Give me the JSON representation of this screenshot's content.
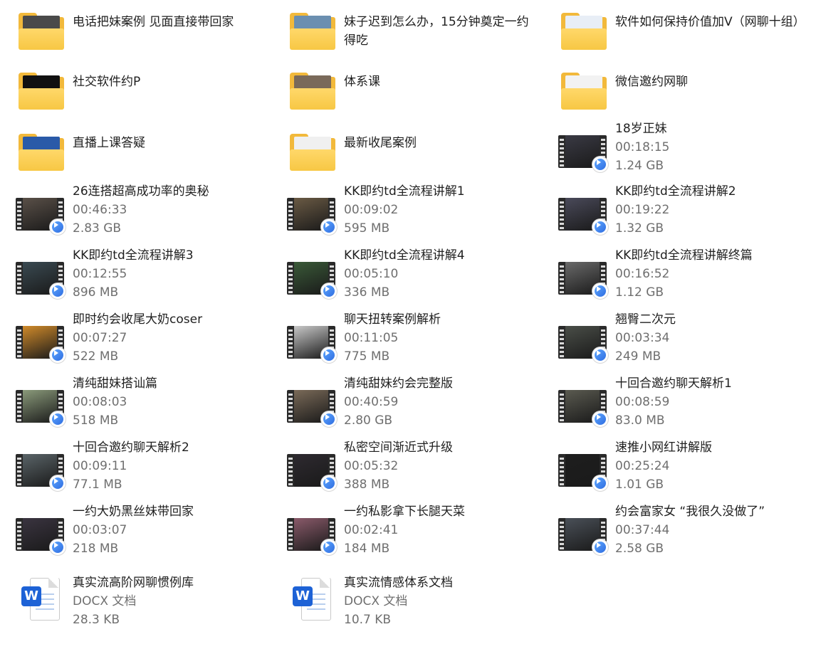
{
  "accent": "#2f6de0",
  "folder_color": "#f7c744",
  "items": [
    {
      "kind": "folder",
      "name": "电话把妹案例 见面直接带回家",
      "paper": "#4a4a4a",
      "icon": "folder-icon"
    },
    {
      "kind": "folder",
      "name": "妹子迟到怎么办，15分钟奠定一约得吃",
      "paper": "#6b8fb0",
      "icon": "folder-icon"
    },
    {
      "kind": "folder",
      "name": "软件如何保持价值加V（网聊十组）",
      "paper": "#e8eef6",
      "icon": "folder-icon"
    },
    {
      "kind": "folder",
      "name": "社交软件约P",
      "paper": "#111111",
      "icon": "folder-icon"
    },
    {
      "kind": "folder",
      "name": "体系课",
      "paper": "#7a6a5a",
      "icon": "folder-icon"
    },
    {
      "kind": "folder",
      "name": "微信邀约网聊",
      "paper": "#f2f2f2",
      "icon": "folder-icon"
    },
    {
      "kind": "folder",
      "name": "直播上课答疑",
      "paper": "#2a5aa8",
      "icon": "folder-icon"
    },
    {
      "kind": "folder",
      "name": "最新收尾案例",
      "paper": "#f0f0f0",
      "icon": "folder-icon"
    },
    {
      "kind": "video",
      "name": "18岁正妹",
      "duration": "00:18:15",
      "size": "1.24 GB",
      "frame": "#3a3a44",
      "icon": "video-icon"
    },
    {
      "kind": "video",
      "name": "26连搭超高成功率的奥秘",
      "duration": "00:46:33",
      "size": "2.83 GB",
      "frame": "#5a5048",
      "icon": "video-icon"
    },
    {
      "kind": "video",
      "name": "KK即约td全流程讲解1",
      "duration": "00:09:02",
      "size": "595 MB",
      "frame": "#6a5a44",
      "icon": "video-icon"
    },
    {
      "kind": "video",
      "name": "KK即约td全流程讲解2",
      "duration": "00:19:22",
      "size": "1.32 GB",
      "frame": "#4a4a5a",
      "icon": "video-icon"
    },
    {
      "kind": "video",
      "name": "KK即约td全流程讲解3",
      "duration": "00:12:55",
      "size": "896 MB",
      "frame": "#3a4a52",
      "icon": "video-icon"
    },
    {
      "kind": "video",
      "name": "KK即约td全流程讲解4",
      "duration": "00:05:10",
      "size": "336 MB",
      "frame": "#3a5a38",
      "icon": "video-icon"
    },
    {
      "kind": "video",
      "name": "KK即约td全流程讲解终篇",
      "duration": "00:16:52",
      "size": "1.12 GB",
      "frame": "#6a6a6a",
      "icon": "video-icon"
    },
    {
      "kind": "video",
      "name": "即时约会收尾大奶coser",
      "duration": "00:07:27",
      "size": "522 MB",
      "frame": "#d08a2a",
      "icon": "video-icon"
    },
    {
      "kind": "video",
      "name": "聊天扭转案例解析",
      "duration": "00:11:05",
      "size": "775 MB",
      "frame": "#c8c8c8",
      "icon": "video-icon"
    },
    {
      "kind": "video",
      "name": "翘臀二次元",
      "duration": "00:03:34",
      "size": "249 MB",
      "frame": "#4a4e48",
      "icon": "video-icon"
    },
    {
      "kind": "video",
      "name": "清纯甜妹搭讪篇",
      "duration": "00:08:03",
      "size": "518 MB",
      "frame": "#8a9a7a",
      "icon": "video-icon"
    },
    {
      "kind": "video",
      "name": "清纯甜妹约会完整版",
      "duration": "00:40:59",
      "size": "2.80 GB",
      "frame": "#7a6a58",
      "icon": "video-icon"
    },
    {
      "kind": "video",
      "name": "十回合邀约聊天解析1",
      "duration": "00:08:59",
      "size": "83.0 MB",
      "frame": "#5a5a50",
      "icon": "video-icon"
    },
    {
      "kind": "video",
      "name": "十回合邀约聊天解析2",
      "duration": "00:09:11",
      "size": "77.1 MB",
      "frame": "#5a6468",
      "icon": "video-icon"
    },
    {
      "kind": "video",
      "name": "私密空间渐近式升级",
      "duration": "00:05:32",
      "size": "388 MB",
      "frame": "#2e2a30",
      "icon": "video-icon"
    },
    {
      "kind": "video",
      "name": "速推小网红讲解版",
      "duration": "00:25:24",
      "size": "1.01 GB",
      "frame": "#1e1e1e",
      "icon": "video-icon"
    },
    {
      "kind": "video",
      "name": "一约大奶黑丝妹带回家",
      "duration": "00:03:07",
      "size": "218 MB",
      "frame": "#3a3440",
      "icon": "video-icon"
    },
    {
      "kind": "video",
      "name": "一约私影拿下长腿天菜",
      "duration": "00:02:41",
      "size": "184 MB",
      "frame": "#8a5a6a",
      "icon": "video-icon"
    },
    {
      "kind": "video",
      "name": "约会富家女 “我很久没做了”",
      "duration": "00:37:44",
      "size": "2.58 GB",
      "frame": "#4a5058",
      "icon": "video-icon"
    },
    {
      "kind": "docx",
      "name": "真实流高阶网聊惯例库",
      "type": "DOCX 文档",
      "size": "28.3 KB",
      "badge": "W",
      "icon": "word-doc-icon"
    },
    {
      "kind": "docx",
      "name": "真实流情感体系文档",
      "type": "DOCX 文档",
      "size": "10.7 KB",
      "badge": "W",
      "icon": "word-doc-icon"
    }
  ]
}
